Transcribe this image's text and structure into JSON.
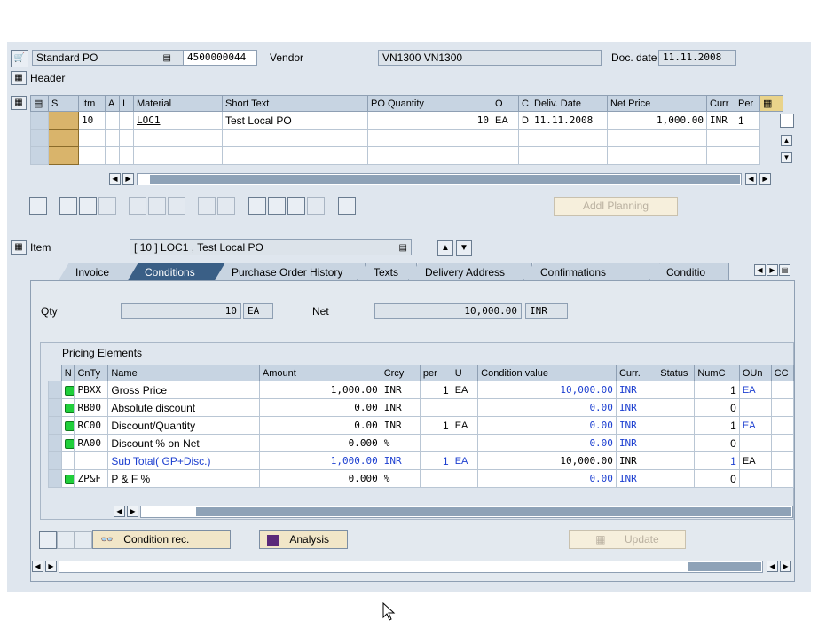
{
  "header": {
    "po_type": "Standard PO",
    "po_number": "4500000044",
    "vendor_label": "Vendor",
    "vendor_value": "VN1300 VN1300",
    "doc_date_label": "Doc. date",
    "doc_date_value": "11.11.2008",
    "header_label": "Header"
  },
  "items_table": {
    "columns": [
      "S",
      "Itm",
      "A",
      "I",
      "Material",
      "Short Text",
      "PO Quantity",
      "O",
      "C",
      "Deliv. Date",
      "Net Price",
      "Curr",
      "Per"
    ],
    "rows": [
      {
        "itm": "10",
        "material": "LOC1",
        "short_text": "Test Local PO",
        "qty": "10",
        "o": "EA",
        "c": "D",
        "deliv": "11.11.2008",
        "net_price": "1,000.00",
        "curr": "INR",
        "per": "1"
      }
    ]
  },
  "addl_planning_label": "Addl Planning",
  "item_section": {
    "label": "Item",
    "selected_item": "[ 10 ] LOC1 , Test Local PO"
  },
  "tabs": [
    "Invoice",
    "Conditions",
    "Purchase Order History",
    "Texts",
    "Delivery Address",
    "Confirmations",
    "Conditio"
  ],
  "qty_row": {
    "qty_label": "Qty",
    "qty_value": "10",
    "qty_unit": "EA",
    "net_label": "Net",
    "net_value": "10,000.00",
    "net_curr": "INR"
  },
  "pricing": {
    "title": "Pricing Elements",
    "columns": [
      "N",
      "CnTy",
      "Name",
      "Amount",
      "Crcy",
      "per",
      "U",
      "Condition value",
      "Curr.",
      "Status",
      "NumC",
      "OUn",
      "CC"
    ],
    "rows": [
      {
        "cnty": "PBXX",
        "name": "Gross Price",
        "amount": "1,000.00",
        "crcy": "INR",
        "per": "1",
        "u": "EA",
        "cond_value": "10,000.00",
        "curr": "INR",
        "numc": "1",
        "oun": "EA",
        "light": true
      },
      {
        "cnty": "RB00",
        "name": "Absolute discount",
        "amount": "0.00",
        "crcy": "INR",
        "per": "",
        "u": "",
        "cond_value": "0.00",
        "curr": "INR",
        "numc": "0",
        "oun": "",
        "light": true
      },
      {
        "cnty": "RC00",
        "name": "Discount/Quantity",
        "amount": "0.00",
        "crcy": "INR",
        "per": "1",
        "u": "EA",
        "cond_value": "0.00",
        "curr": "INR",
        "numc": "1",
        "oun": "EA",
        "light": true
      },
      {
        "cnty": "RA00",
        "name": "Discount % on Net",
        "amount": "0.000",
        "crcy": "%",
        "per": "",
        "u": "",
        "cond_value": "0.00",
        "curr": "INR",
        "numc": "0",
        "oun": "",
        "light": true
      },
      {
        "cnty": "",
        "name": "Sub Total( GP+Disc.)",
        "amount": "1,000.00",
        "crcy": "INR",
        "per": "1",
        "u": "EA",
        "cond_value": "10,000.00",
        "curr": "INR",
        "numc": "1",
        "oun": "EA",
        "light": false
      },
      {
        "cnty": "ZP&F",
        "name": "P & F %",
        "amount": "0.000",
        "crcy": "%",
        "per": "",
        "u": "",
        "cond_value": "0.00",
        "curr": "INR",
        "numc": "0",
        "oun": "",
        "light": true
      }
    ]
  },
  "buttons": {
    "condition_rec": "Condition rec.",
    "analysis": "Analysis",
    "update": "Update"
  },
  "colors": {
    "screen_bg": "#dfe6ee",
    "active_tab": "#3a5f86",
    "condition_link": "#1c3fd0",
    "status_green": "#1fcf3a"
  }
}
